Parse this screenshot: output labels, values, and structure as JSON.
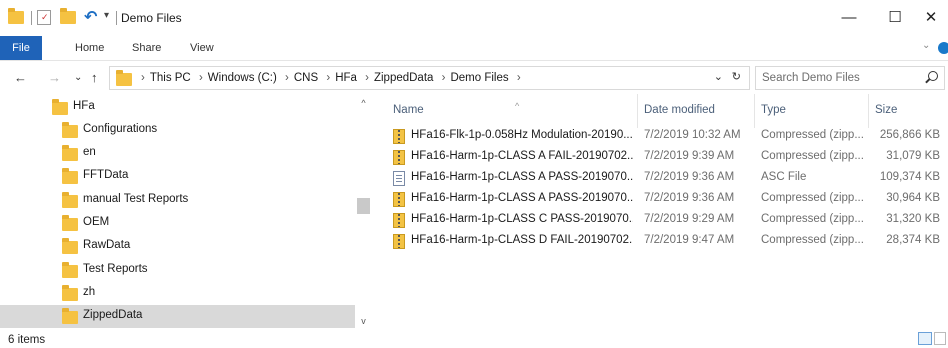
{
  "window": {
    "title": "Demo Files",
    "minimize_glyph": "—",
    "maximize_glyph": "☐",
    "close_glyph": "✕",
    "qa_customize_glyph": "▾",
    "undo_glyph": "↶"
  },
  "ribbon": {
    "tabs": [
      {
        "label": "File"
      },
      {
        "label": "Home"
      },
      {
        "label": "Share"
      },
      {
        "label": "View"
      }
    ],
    "expand_glyph": "⌄",
    "accent_color": "#1f63b8"
  },
  "address": {
    "back_glyph": "←",
    "forward_glyph": "→",
    "recent_glyph": "⌄",
    "up_glyph": "↑",
    "crumbs": [
      "This PC",
      "Windows (C:)",
      "CNS",
      "HFa",
      "ZippedData",
      "Demo Files"
    ],
    "separator": "›",
    "dropdown_glyph": "⌄",
    "refresh_glyph": "↻",
    "search_placeholder": "Search Demo Files"
  },
  "nav": {
    "root": "HFa",
    "items": [
      {
        "label": "Configurations"
      },
      {
        "label": "en"
      },
      {
        "label": "FFTData"
      },
      {
        "label": "manual Test Reports"
      },
      {
        "label": "OEM"
      },
      {
        "label": "RawData"
      },
      {
        "label": "Test Reports"
      },
      {
        "label": "zh"
      },
      {
        "label": "ZippedData"
      }
    ],
    "selected": "ZippedData",
    "scroll_up_glyph": "^",
    "scroll_down_glyph": "v"
  },
  "filelist": {
    "columns": {
      "name": "Name",
      "date": "Date modified",
      "type": "Type",
      "size": "Size"
    },
    "sort_glyph": "^",
    "files": [
      {
        "icon": "zip-icon",
        "name": "HFa16-Flk-1p-0.058Hz Modulation-20190...",
        "date": "7/2/2019 10:32 AM",
        "type": "Compressed (zipp...",
        "size": "256,866 KB"
      },
      {
        "icon": "zip-icon",
        "name": "HFa16-Harm-1p-CLASS A FAIL-20190702...",
        "date": "7/2/2019 9:39 AM",
        "type": "Compressed (zipp...",
        "size": "31,079 KB"
      },
      {
        "icon": "asc-file-icon",
        "name": "HFa16-Harm-1p-CLASS A PASS-2019070...",
        "date": "7/2/2019 9:36 AM",
        "type": "ASC File",
        "size": "109,374 KB"
      },
      {
        "icon": "zip-icon",
        "name": "HFa16-Harm-1p-CLASS A PASS-2019070...",
        "date": "7/2/2019 9:36 AM",
        "type": "Compressed (zipp...",
        "size": "30,964 KB"
      },
      {
        "icon": "zip-icon",
        "name": "HFa16-Harm-1p-CLASS C PASS-2019070...",
        "date": "7/2/2019 9:29 AM",
        "type": "Compressed (zipp...",
        "size": "31,320 KB"
      },
      {
        "icon": "zip-icon",
        "name": "HFa16-Harm-1p-CLASS D FAIL-20190702...",
        "date": "7/2/2019 9:47 AM",
        "type": "Compressed (zipp...",
        "size": "28,374 KB"
      }
    ]
  },
  "status": {
    "item_count": "6 items"
  }
}
